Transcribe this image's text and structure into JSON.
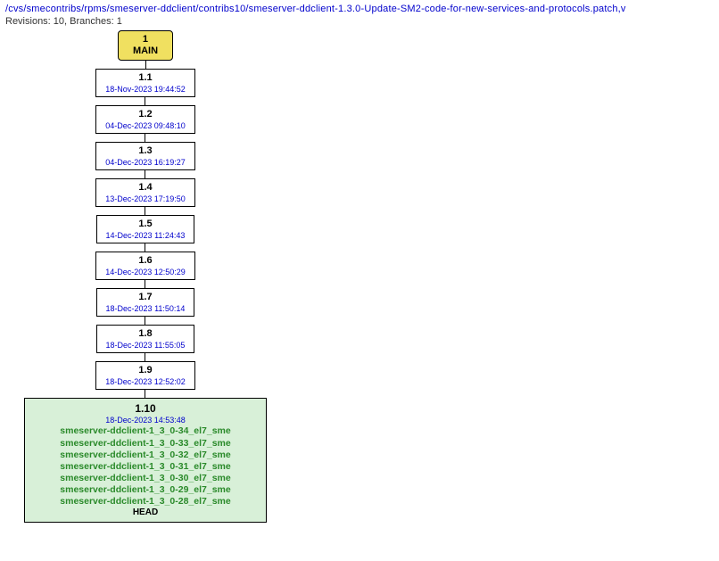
{
  "header": {
    "breadcrumb": "/cvs/smecontribs/rpms/smeserver-ddclient/contribs10/smeserver-ddclient-1.3.0-Update-SM2-code-for-new-services-and-protocols.patch,v",
    "summary": "Revisions: 10, Branches: 1"
  },
  "main_branch": {
    "id": "1",
    "name": "MAIN"
  },
  "revisions": [
    {
      "rev": "1.1",
      "date": "18-Nov-2023 19:44:52"
    },
    {
      "rev": "1.2",
      "date": "04-Dec-2023 09:48:10"
    },
    {
      "rev": "1.3",
      "date": "04-Dec-2023 16:19:27"
    },
    {
      "rev": "1.4",
      "date": "13-Dec-2023 17:19:50"
    },
    {
      "rev": "1.5",
      "date": "14-Dec-2023 11:24:43"
    },
    {
      "rev": "1.6",
      "date": "14-Dec-2023 12:50:29"
    },
    {
      "rev": "1.7",
      "date": "18-Dec-2023 11:50:14"
    },
    {
      "rev": "1.8",
      "date": "18-Dec-2023 11:55:05"
    },
    {
      "rev": "1.9",
      "date": "18-Dec-2023 12:52:02"
    }
  ],
  "head_revision": {
    "rev": "1.10",
    "date": "18-Dec-2023 14:53:48",
    "tags": [
      "smeserver-ddclient-1_3_0-34_el7_sme",
      "smeserver-ddclient-1_3_0-33_el7_sme",
      "smeserver-ddclient-1_3_0-32_el7_sme",
      "smeserver-ddclient-1_3_0-31_el7_sme",
      "smeserver-ddclient-1_3_0-30_el7_sme",
      "smeserver-ddclient-1_3_0-29_el7_sme",
      "smeserver-ddclient-1_3_0-28_el7_sme"
    ],
    "head_label": "HEAD"
  }
}
